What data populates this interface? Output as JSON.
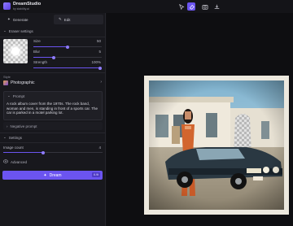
{
  "app": {
    "title": "DreamStudio",
    "subtitle": "by stability.ai",
    "accent": "#6b54f0"
  },
  "topbar": {
    "icons": [
      "cursor-icon",
      "eraser-icon",
      "camera-icon",
      "download-icon"
    ]
  },
  "tabs": [
    {
      "label": "Generate",
      "icon": "sparkle-icon"
    },
    {
      "label": "Edit",
      "icon": "pencil-icon"
    }
  ],
  "eraser_settings": {
    "header": "Eraser settings",
    "sliders": [
      {
        "label": "Size",
        "value": "50",
        "fraction": 0.5
      },
      {
        "label": "Blur",
        "value": "5",
        "fraction": 0.3
      },
      {
        "label": "Strength",
        "value": "100%",
        "fraction": 1.0
      }
    ]
  },
  "style": {
    "label": "Style",
    "value": "Photographic"
  },
  "prompt": {
    "header": "Prompt",
    "text": "A rock album cover from the 1970s. The rock band, woman and men, is standing in front of a sports car. The car is parked in a motel parking lot."
  },
  "negative_prompt": {
    "label": "Negative prompt"
  },
  "settings": {
    "header": "Settings",
    "image_count_label": "Image count",
    "image_count_value": "4",
    "image_count_fraction": 0.4
  },
  "advanced": {
    "label": "Advanced"
  },
  "dream": {
    "label": "Dream",
    "cost": "6.9t"
  }
}
